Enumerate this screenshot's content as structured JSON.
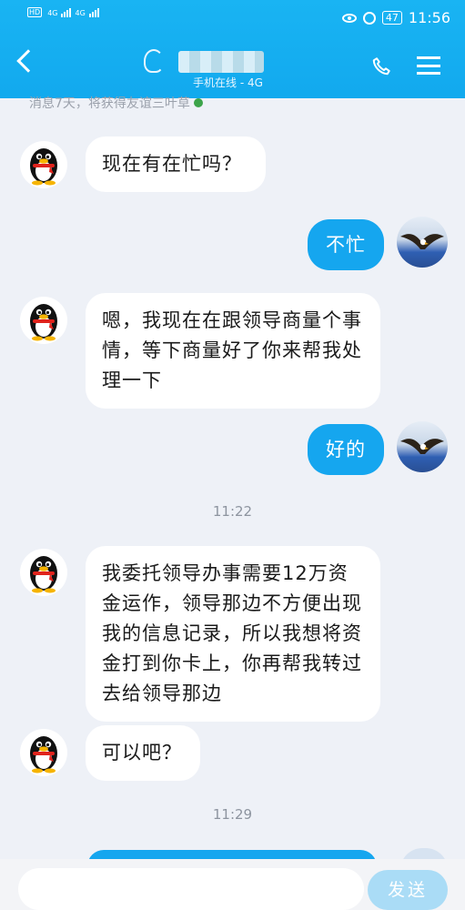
{
  "status_bar": {
    "network_badge_1": "HD",
    "network_badge_2": "HD",
    "signal_1": "4G",
    "signal_2": "4G",
    "battery": "47",
    "time": "11:56"
  },
  "header": {
    "online_status": "手机在线 - 4G"
  },
  "hint": {
    "text": "消息7天，将获得友谊三叶草"
  },
  "messages": [
    {
      "side": "in",
      "text": "现在有在忙吗？"
    },
    {
      "side": "out",
      "text": "不忙"
    },
    {
      "side": "in",
      "text": "嗯，我现在在跟领导商量个事情，等下商量好了你来帮我处理一下"
    },
    {
      "side": "out",
      "text": "好的"
    },
    {
      "side": "time",
      "text": "11:22"
    },
    {
      "side": "in",
      "text": "我委托领导办事需要12万资金运作，领导那边不方便出现我的信息记录，所以我想将资金打到你卡上，你再帮我转过去给领导那边"
    },
    {
      "side": "in",
      "text": "可以吧？"
    },
    {
      "side": "time",
      "text": "11:29"
    }
  ],
  "input": {
    "send_label": "发送"
  },
  "icons": {
    "back": "back-arrow-icon",
    "ear": "ear-icon",
    "phone": "phone-icon",
    "menu": "menu-icon",
    "penguin_avatar": "qq-penguin-avatar",
    "eagle_avatar": "eagle-avatar"
  },
  "colors": {
    "header_blue": "#12a9ee",
    "bubble_out": "#15a6ef",
    "bubble_in": "#ffffff",
    "background": "#eef1f7",
    "send_button": "#aadcf6"
  }
}
